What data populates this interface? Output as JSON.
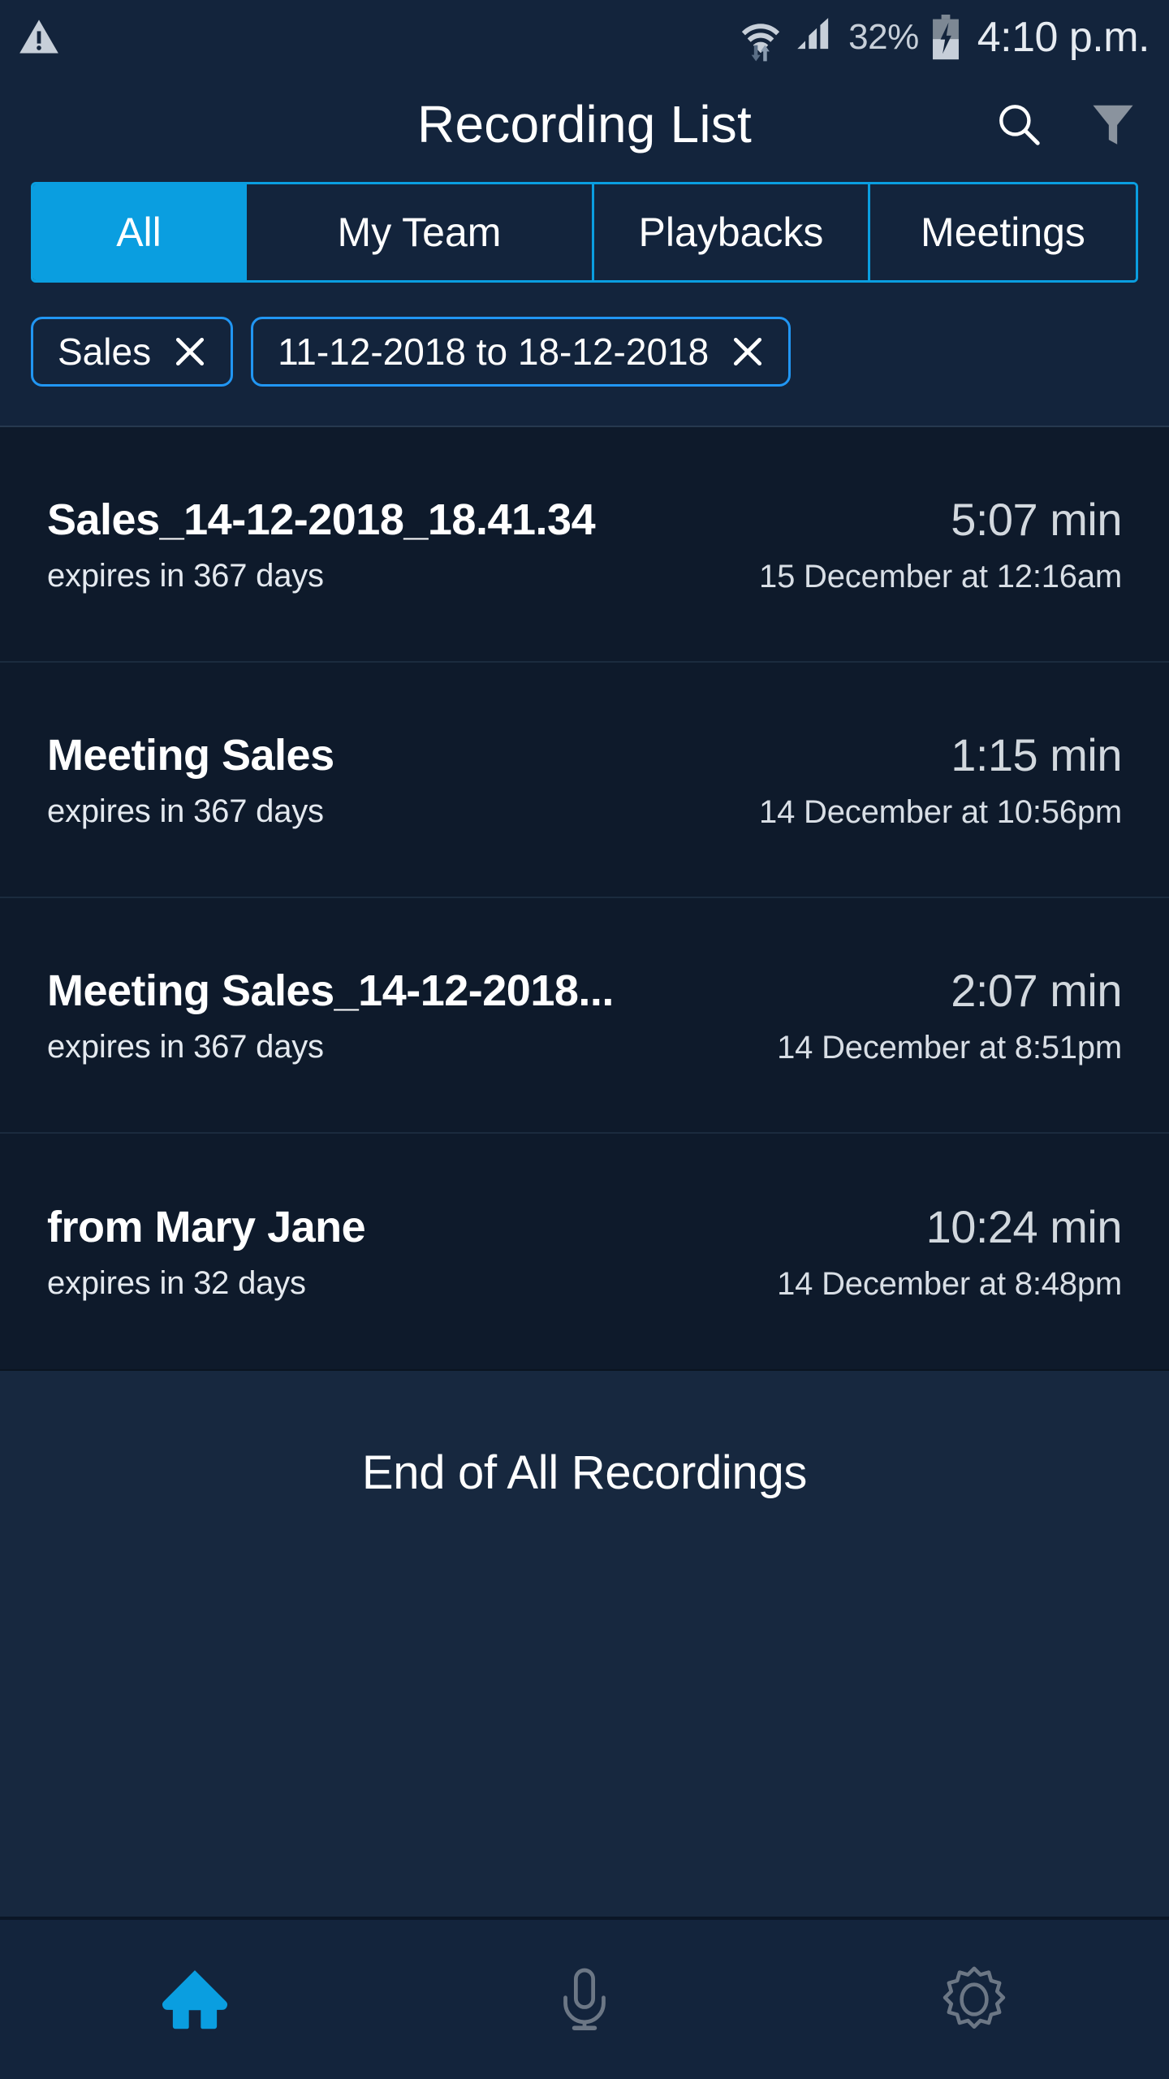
{
  "status_bar": {
    "warning_icon": "warning-triangle-icon",
    "wifi_icon": "wifi-transfer-icon",
    "signal_icon": "cellular-signal-icon",
    "battery_percent": "32%",
    "battery_icon": "battery-charging-icon",
    "time": "4:10 p.m."
  },
  "header": {
    "title": "Recording List",
    "search_icon": "search-icon",
    "filter_icon": "filter-funnel-icon"
  },
  "tabs": {
    "items": [
      {
        "label": "All",
        "active": true
      },
      {
        "label": "My Team",
        "active": false
      },
      {
        "label": "Playbacks",
        "active": false
      },
      {
        "label": "Meetings",
        "active": false
      }
    ]
  },
  "filter_chips": [
    {
      "label": "Sales"
    },
    {
      "label": "11-12-2018 to 18-12-2018"
    }
  ],
  "recordings": [
    {
      "title": "Sales_14-12-2018_18.41.34",
      "expiry": "expires in 367 days",
      "duration": "5:07 min",
      "date": "15 December at 12:16am"
    },
    {
      "title": "Meeting Sales",
      "expiry": "expires in 367 days",
      "duration": "1:15 min",
      "date": "14 December at 10:56pm"
    },
    {
      "title": "Meeting Sales_14-12-2018...",
      "expiry": "expires in 367 days",
      "duration": "2:07 min",
      "date": "14 December at 8:51pm"
    },
    {
      "title": "from Mary Jane",
      "expiry": "expires in 32 days",
      "duration": "10:24 min",
      "date": "14 December at 8:48pm"
    }
  ],
  "list_footer": {
    "end_text": "End of All Recordings"
  },
  "bottom_nav": {
    "items": [
      {
        "icon": "home-icon",
        "active": true
      },
      {
        "icon": "microphone-icon",
        "active": false
      },
      {
        "icon": "gear-icon",
        "active": false
      }
    ]
  },
  "colors": {
    "background": "#13243c",
    "list_background": "#0e1a2b",
    "footer_background": "#17283f",
    "accent_blue": "#0a9ee0",
    "chip_border": "#2196f3",
    "text_primary": "#ffffff",
    "text_secondary": "#d2d8de",
    "icon_gray": "#8a939e"
  }
}
